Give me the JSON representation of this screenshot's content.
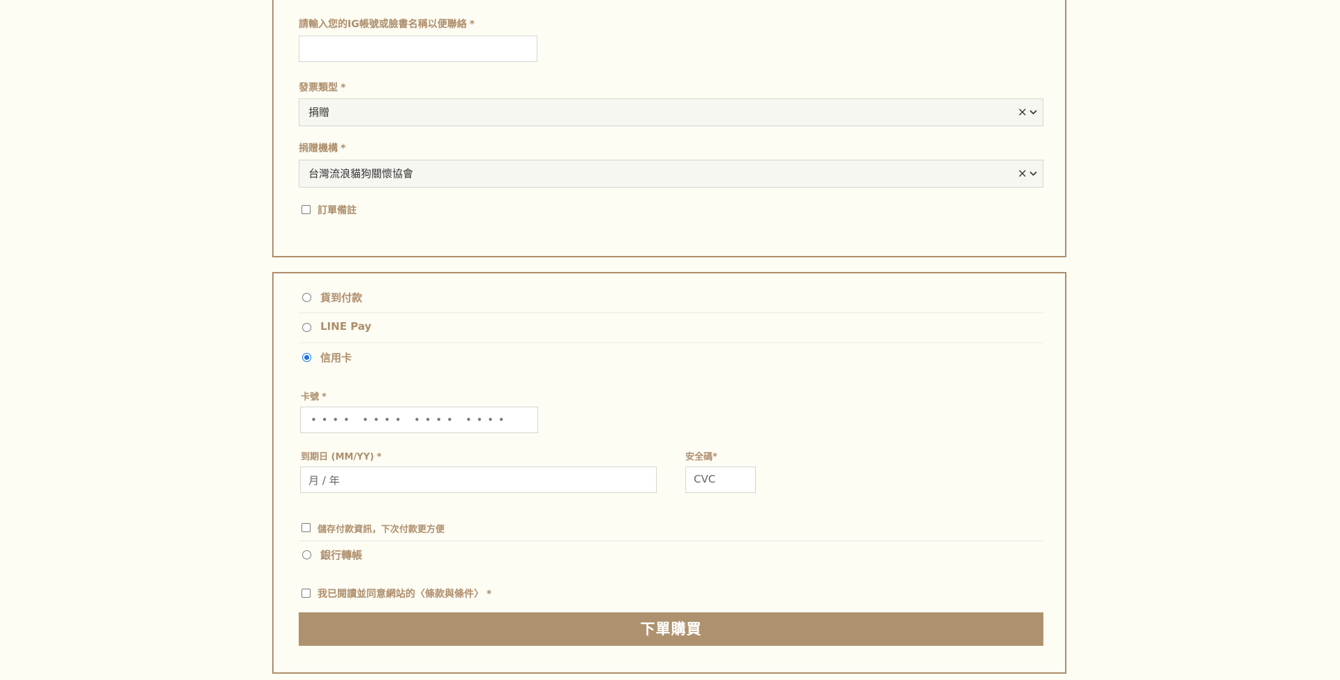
{
  "form": {
    "ig_label": "請輸入您的IG帳號或臉書名稱以便聯絡",
    "ig_value": "",
    "invoice_type_label": "發票類型",
    "invoice_type_value": "捐贈",
    "donation_org_label": "捐贈機構",
    "donation_org_value": "台灣流浪貓狗關懷協會",
    "order_note_label": "訂單備註",
    "required_mark": "*"
  },
  "payment": {
    "options": [
      {
        "label": "貨到付款",
        "selected": false
      },
      {
        "label": "LINE Pay",
        "selected": false
      },
      {
        "label": "信用卡",
        "selected": true
      }
    ],
    "card_number_label": "卡號",
    "card_number_placeholder": "• • • •   • • • •   • • • •   • • • •",
    "expiry_label": "到期日 (MM/YY)",
    "expiry_placeholder": "月 / 年",
    "cvc_label": "安全碼*",
    "cvc_placeholder": "CVC",
    "save_payment_label": "儲存付款資訊，下次付款更方便",
    "bank_transfer_label": "銀行轉帳",
    "terms_prefix": "我已閱讀並同意網站的",
    "terms_link": "〈條款與條件〉",
    "submit_label": "下單購買"
  },
  "icons": {
    "clear": "close-icon",
    "dropdown": "chevron-down-icon"
  },
  "colors": {
    "accent": "#ae8e6c",
    "button": "#ae9270",
    "background": "#fdfdf4",
    "radio_selected": "#1a73e8"
  }
}
